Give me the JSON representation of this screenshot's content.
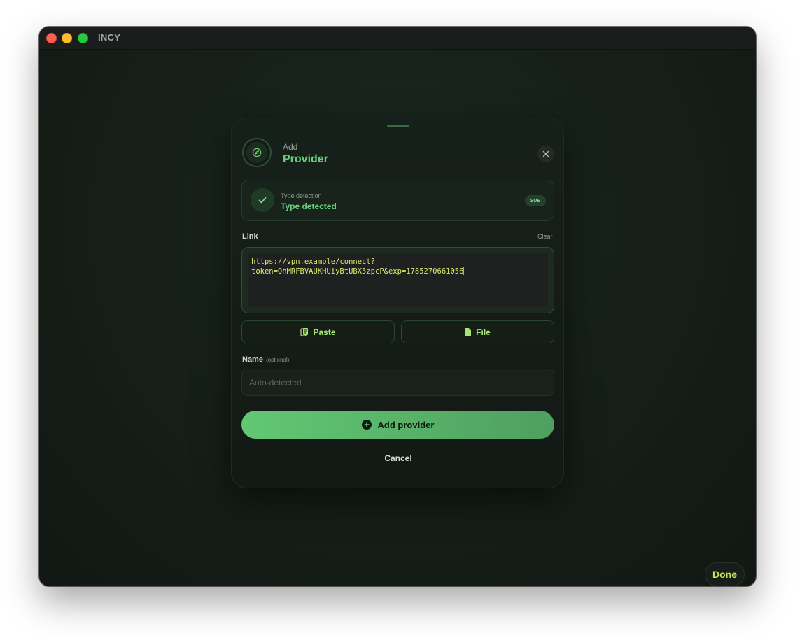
{
  "window": {
    "title": "INCY",
    "done_label": "Done"
  },
  "modal": {
    "header": {
      "subtitle": "Add",
      "title": "Provider",
      "icon": "compass-icon"
    },
    "detection": {
      "label": "Type detection",
      "value": "Type detected",
      "badge": "SUB"
    },
    "link": {
      "label": "Link",
      "clear_label": "Clear",
      "value": "https://vpn.example/connect?\ntoken=QhMRFBVAUKHUiyBtUBX5zpcP&exp=1785270661056"
    },
    "actions": {
      "paste_label": "Paste",
      "file_label": "File"
    },
    "name": {
      "label": "Name",
      "optional_label": "(optional)",
      "placeholder": "Auto-detected",
      "value": ""
    },
    "add_button_label": "Add provider",
    "cancel_label": "Cancel"
  },
  "colors": {
    "accent": "#6bd07a",
    "link_text": "#d9ea6a",
    "done_text": "#c9e35a"
  }
}
